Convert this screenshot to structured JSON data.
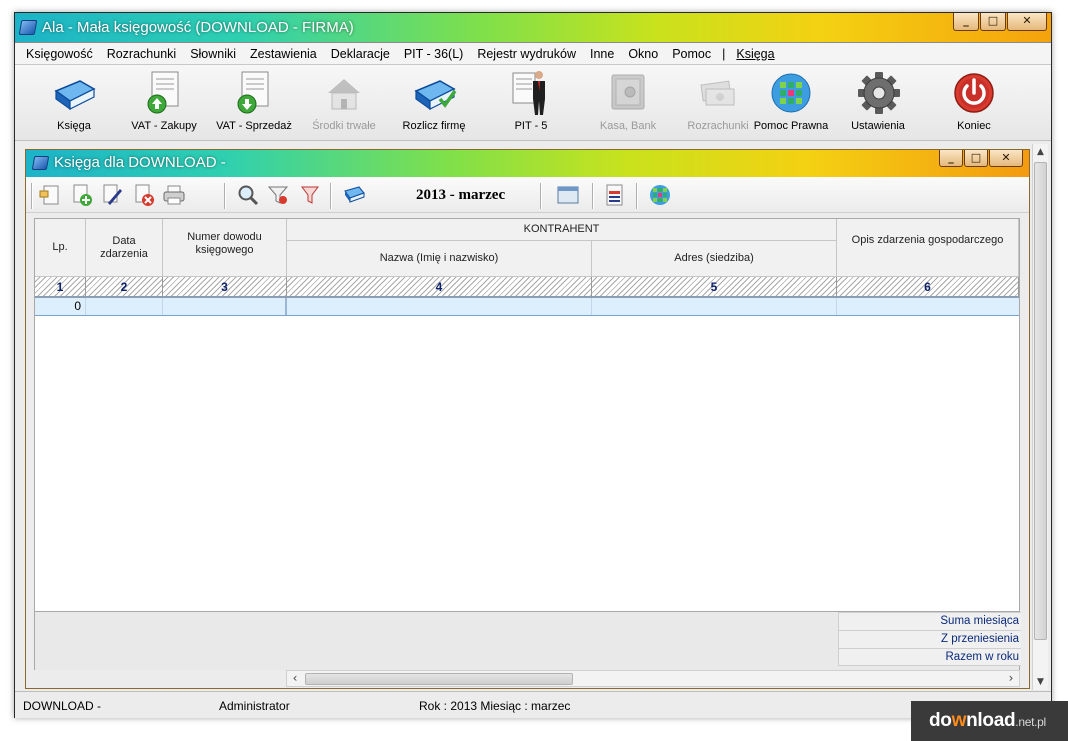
{
  "window": {
    "title": "Ala - Mała księgowość (DOWNLOAD - FIRMA)"
  },
  "menu": {
    "items": [
      "Księgowość",
      "Rozrachunki",
      "Słowniki",
      "Zestawienia",
      "Deklaracje",
      "PIT - 36(L)",
      "Rejestr wydruków",
      "Inne",
      "Okno",
      "Pomoc",
      "|",
      "Księga"
    ]
  },
  "toolbar": {
    "buttons": [
      {
        "label": "Księga",
        "icon": "book-icon",
        "enabled": true
      },
      {
        "label": "VAT - Zakupy",
        "icon": "vat-purchases-icon",
        "enabled": true
      },
      {
        "label": "VAT - Sprzedaż",
        "icon": "vat-sales-icon",
        "enabled": true
      },
      {
        "label": "Środki trwałe",
        "icon": "fixed-assets-icon",
        "enabled": false
      },
      {
        "label": "Rozlicz firmę",
        "icon": "settle-company-icon",
        "enabled": true
      },
      {
        "label": "PIT - 5",
        "icon": "pit5-icon",
        "enabled": true
      },
      {
        "label": "Kasa, Bank",
        "icon": "safe-icon",
        "enabled": false
      },
      {
        "label": "Rozrachunki",
        "icon": "money-icon",
        "enabled": false
      },
      {
        "label": "Pomoc Prawna",
        "icon": "legal-help-icon",
        "enabled": true
      },
      {
        "label": "Ustawienia",
        "icon": "gear-icon",
        "enabled": true
      },
      {
        "label": "Koniec",
        "icon": "power-icon",
        "enabled": true
      }
    ]
  },
  "child": {
    "title": "Księga dla DOWNLOAD -",
    "period": "2013 - marzec",
    "table": {
      "headers": {
        "lp": "Lp.",
        "date": "Data zdarzenia",
        "doc_number": "Numer dowodu księgowego",
        "contractor": "KONTRAHENT",
        "name": "Nazwa (Imię i nazwisko)",
        "address": "Adres (siedziba)",
        "description": "Opis zdarzenia gospodarczego"
      },
      "column_numbers": [
        "1",
        "2",
        "3",
        "4",
        "5",
        "6"
      ],
      "rows": [
        {
          "lp": "0",
          "date": "",
          "doc_number": "",
          "name": "",
          "address": "",
          "description": ""
        }
      ]
    },
    "summary": [
      "Suma miesiąca",
      "Z przeniesienia",
      "Razem w roku"
    ]
  },
  "status": {
    "company": "DOWNLOAD -",
    "user": "Administrator",
    "period": "Rok : 2013  Miesiąc : marzec"
  },
  "watermark": {
    "pre": "do",
    "o": "w",
    "post": "nload",
    "suffix": ".net.pl"
  },
  "colors": {
    "accent": "#0b1f6b",
    "selection": "#ddeefc",
    "title_gradient_start": "#1cb3c8",
    "title_gradient_end": "#f5a20c"
  }
}
